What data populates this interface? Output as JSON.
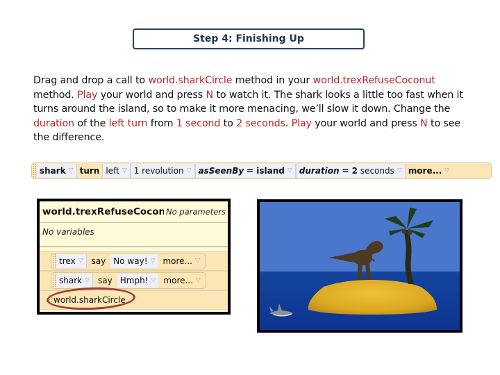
{
  "title": "Step 4: Finishing Up",
  "instructions": [
    {
      "t": "Drag and drop a call to ",
      "hl": false
    },
    {
      "t": "world.sharkCircle",
      "hl": true
    },
    {
      "t": " method in your ",
      "hl": false
    },
    {
      "t": "world.trexRefuseCoconut",
      "hl": true
    },
    {
      "t": " method. ",
      "hl": false
    },
    {
      "t": "Play",
      "hl": true
    },
    {
      "t": " your world and press ",
      "hl": false
    },
    {
      "t": "N",
      "hl": true
    },
    {
      "t": " to watch it. The shark looks a little too fast when it turns around the island, so to make it more menacing, we’ll slow it down. Change the ",
      "hl": false
    },
    {
      "t": "duration",
      "hl": true
    },
    {
      "t": " of the ",
      "hl": false
    },
    {
      "t": "left turn",
      "hl": true
    },
    {
      "t": " from ",
      "hl": false
    },
    {
      "t": "1 second",
      "hl": true
    },
    {
      "t": " to ",
      "hl": false
    },
    {
      "t": "2 seconds",
      "hl": true
    },
    {
      "t": ". ",
      "hl": false
    },
    {
      "t": "Play",
      "hl": true
    },
    {
      "t": " your world and press ",
      "hl": false
    },
    {
      "t": "N",
      "hl": true
    },
    {
      "t": " to see the difference.",
      "hl": false
    }
  ],
  "tile_bar": {
    "object": "shark",
    "method": "turn",
    "direction": "left",
    "amount": "1 revolution",
    "as_seen_by_label": "asSeenBy",
    "as_seen_by_value": "= island",
    "duration_label": "duration",
    "duration_value": "= 2",
    "duration_unit": "seconds",
    "more": "more..."
  },
  "editor": {
    "method_name": "world.trexRefuseCoconut",
    "parameters": "No parameters",
    "variables": "No variables",
    "statements": [
      {
        "object": "trex",
        "verb": "say",
        "value": "No way!",
        "more": "more..."
      },
      {
        "object": "shark",
        "verb": "say",
        "value": "Hmph!",
        "more": "more..."
      }
    ],
    "call": "world.sharkCircle"
  },
  "scene": {
    "sky_color": "#4a77cc",
    "sea_color": "#0f3d9a",
    "island_color": "#e0b028",
    "objects": [
      "trex",
      "palm-tree",
      "island",
      "shark"
    ]
  },
  "icons": {
    "dropdown": "▽"
  }
}
